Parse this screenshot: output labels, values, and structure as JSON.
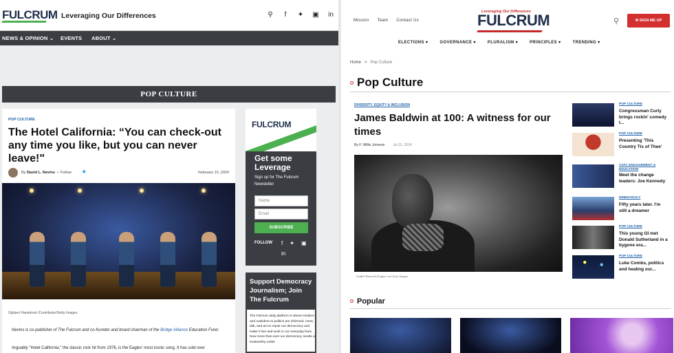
{
  "left": {
    "logo": "FULCRUM",
    "tagline": "Leveraging Our Differences",
    "social_icons": [
      "search-icon",
      "facebook-icon",
      "twitter-icon",
      "instagram-icon",
      "linkedin-icon"
    ],
    "nav": [
      {
        "label": "NEWS & OPINION ⌄"
      },
      {
        "label": "EVENTS"
      },
      {
        "label": "ABOUT ⌄"
      }
    ],
    "section_title": "POP CULTURE",
    "article": {
      "category": "POP CULTURE",
      "title": "The Hotel California: “You can check-out any time you like, but you can never leave!\"",
      "by_prefix": "By",
      "author": "David L. Nevins",
      "follow": "Follow",
      "date": "February 15, 2024",
      "photo_credit": "Gijsbert Hanekroot /Contributor/Getty Images",
      "body1_a": "Nevins is co-publisher of The Fulcrum and co-founder and board chairman of the ",
      "body1_link": "Bridge Alliance",
      "body1_b": " Education Fund.",
      "body2": "Arguably \"Hotel California,\" the classic rock hit from 1976, is the Eagles' most iconic song. It has sold over"
    },
    "promo": {
      "logo": "FULCRUM",
      "heading": "Get some Leverage",
      "sub": "Sign up for The Fulcrum Newsletter",
      "name_placeholder": "Name",
      "email_placeholder": "Email",
      "subscribe": "SUBSCRIBE",
      "follow": "FOLLOW"
    },
    "support": {
      "heading": "Support Democracy Journalism; Join The Fulcrum",
      "body": "The Fulcrum daily platform is where insiders and outsiders to politics are informed, meet, talk, and act to repair our democracy and make it live and work in our everyday lives. Now more than ever our democracy needs a trustworthy outlet"
    }
  },
  "right": {
    "top_links": [
      "Mission",
      "Team",
      "Contact Us"
    ],
    "logo_tag": "Leveraging Our Differences",
    "logo": "FULCRUM",
    "signup": "✉  SIGN ME UP",
    "nav": [
      "ELECTIONS",
      "GOVERNANCE",
      "PLURALISM",
      "PRINCIPLES",
      "TRENDING"
    ],
    "breadcrumb": {
      "home": "Home",
      "sep": ">",
      "current": "Pop Culture"
    },
    "page_title": "Pop Culture",
    "featured": {
      "category": "DIVERSITY, EQUITY & INCLUSION",
      "title": "James Baldwin at 100: A witness for our times",
      "author": "By F. Willis Johnson",
      "date": "Jul 31, 2024",
      "credit": "Sophie Bassouls/Sygma via Getty Images"
    },
    "sidebar": [
      {
        "category": "POP CULTURE",
        "title": "Congressman Curly brings rockin' comedy t..."
      },
      {
        "category": "POP CULTURE",
        "title": "Presenting 'This Country Tis of Thee'"
      },
      {
        "category": "CIVIC ENGAGEMENT & EDUCATION",
        "title": "Meet the change leaders: Joe Kennedy"
      },
      {
        "category": "DEMOCRACY",
        "title": "Fifty years later. I'm still a dreamer"
      },
      {
        "category": "POP CULTURE",
        "title": "This young GI met Donald Sutherland in a bygone era..."
      },
      {
        "category": "POP CULTURE",
        "title": "Luke Combs, politics and healing our..."
      }
    ],
    "popular_title": "Popular"
  },
  "colors": {
    "fulcrum_navy": "#1f2e4a",
    "green": "#4caf50",
    "red": "#d32f2f",
    "dark_bar": "#3a3d42",
    "link_blue": "#1c5fa8"
  }
}
